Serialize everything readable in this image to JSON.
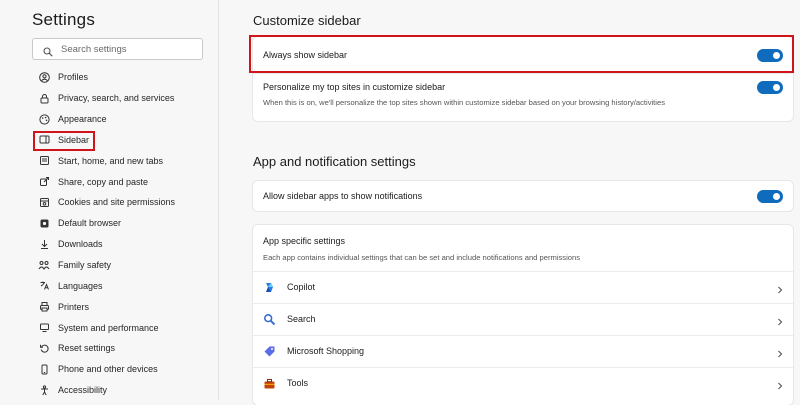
{
  "sidebar": {
    "title": "Settings",
    "search_placeholder": "Search settings",
    "items": [
      {
        "label": "Profiles",
        "icon": "profile-icon"
      },
      {
        "label": "Privacy, search, and services",
        "icon": "lock-icon"
      },
      {
        "label": "Appearance",
        "icon": "palette-icon"
      },
      {
        "label": "Sidebar",
        "icon": "sidebar-icon",
        "active": true
      },
      {
        "label": "Start, home, and new tabs",
        "icon": "home-icon"
      },
      {
        "label": "Share, copy and paste",
        "icon": "share-icon"
      },
      {
        "label": "Cookies and site permissions",
        "icon": "cookie-icon"
      },
      {
        "label": "Default browser",
        "icon": "browser-icon"
      },
      {
        "label": "Downloads",
        "icon": "download-icon"
      },
      {
        "label": "Family safety",
        "icon": "family-icon"
      },
      {
        "label": "Languages",
        "icon": "language-icon"
      },
      {
        "label": "Printers",
        "icon": "printer-icon"
      },
      {
        "label": "System and performance",
        "icon": "system-icon"
      },
      {
        "label": "Reset settings",
        "icon": "reset-icon"
      },
      {
        "label": "Phone and other devices",
        "icon": "phone-icon"
      },
      {
        "label": "Accessibility",
        "icon": "accessibility-icon"
      }
    ]
  },
  "main": {
    "customize": {
      "heading": "Customize sidebar",
      "always_show_label": "Always show sidebar",
      "personalize_label": "Personalize my top sites in customize sidebar",
      "personalize_sub": "When this is on, we'll personalize the top sites shown within customize sidebar based on your browsing history/activities"
    },
    "notifications": {
      "heading": "App and notification settings",
      "allow_label": "Allow sidebar apps to show notifications",
      "app_specific_title": "App specific settings",
      "app_specific_sub": "Each app contains individual settings that can be set and include notifications and permissions",
      "apps": [
        {
          "name": "Copilot",
          "icon": "copilot-icon"
        },
        {
          "name": "Search",
          "icon": "search-icon"
        },
        {
          "name": "Microsoft Shopping",
          "icon": "shopping-tag-icon"
        },
        {
          "name": "Tools",
          "icon": "toolbox-icon"
        }
      ]
    }
  },
  "colors": {
    "accent": "#0f6cbd",
    "highlight": "#d0141b"
  }
}
